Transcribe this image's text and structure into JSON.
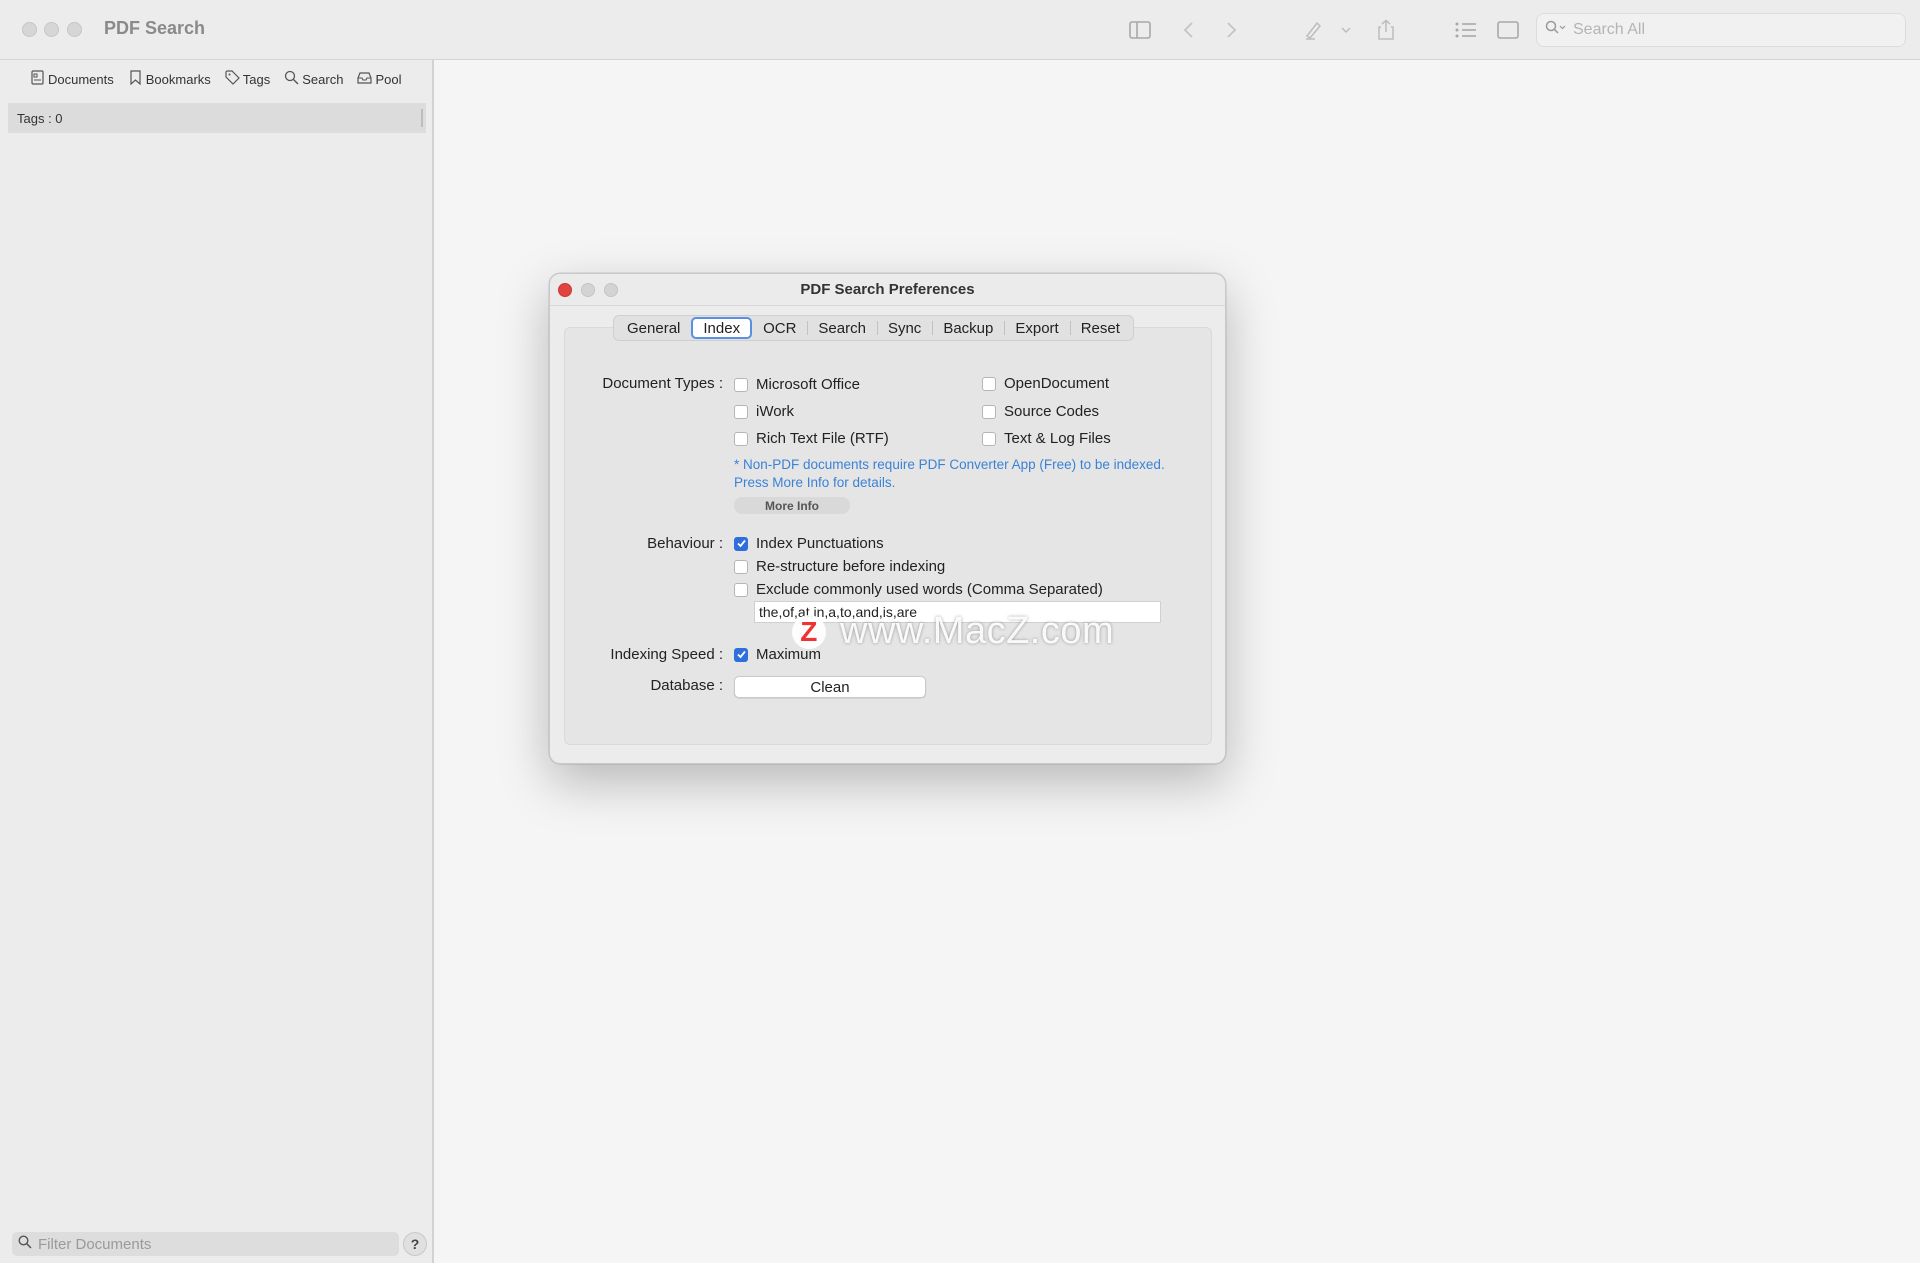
{
  "window": {
    "title": "PDF Search"
  },
  "toolbar": {
    "search_placeholder": "Search All",
    "icons": [
      "sidebar-toggle-icon",
      "back-icon",
      "forward-icon",
      "highlighter-icon",
      "chevron-down-icon",
      "share-icon",
      "list-icon",
      "single-page-icon",
      "search-icon"
    ]
  },
  "sidebar": {
    "tabs": [
      {
        "label": "Documents",
        "icon": "documents-icon"
      },
      {
        "label": "Bookmarks",
        "icon": "bookmark-icon"
      },
      {
        "label": "Tags",
        "icon": "tag-icon"
      },
      {
        "label": "Search",
        "icon": "search-icon"
      },
      {
        "label": "Pool",
        "icon": "tray-icon"
      }
    ],
    "tags_count_label": "Tags : 0",
    "filter_placeholder": "Filter Documents",
    "help_label": "?"
  },
  "dialog": {
    "title": "PDF Search Preferences",
    "tabs": [
      "General",
      "Index",
      "OCR",
      "Search",
      "Sync",
      "Backup",
      "Export",
      "Reset"
    ],
    "active_tab": "Index",
    "document_types": {
      "label": "Document Types :",
      "options": [
        {
          "label": "Microsoft Office",
          "checked": false
        },
        {
          "label": "OpenDocument",
          "checked": false
        },
        {
          "label": "iWork",
          "checked": false
        },
        {
          "label": "Source Codes",
          "checked": false
        },
        {
          "label": "Rich Text File (RTF)",
          "checked": false
        },
        {
          "label": "Text & Log Files",
          "checked": false
        }
      ],
      "note_line1": "* Non-PDF documents require PDF Converter App (Free) to be indexed.",
      "note_line2": "Press More Info for details.",
      "more_info_label": "More Info"
    },
    "behaviour": {
      "label": "Behaviour :",
      "options": [
        {
          "label": "Index Punctuations",
          "checked": true
        },
        {
          "label": "Re-structure before indexing",
          "checked": false
        },
        {
          "label": "Exclude commonly used words (Comma Separated)",
          "checked": false
        }
      ],
      "words_value": "the,of,at,in,a,to,and,is,are"
    },
    "indexing_speed": {
      "label": "Indexing Speed :",
      "option": {
        "label": "Maximum",
        "checked": true
      }
    },
    "database": {
      "label": "Database :",
      "button_label": "Clean"
    }
  },
  "watermark": {
    "logo": "Z",
    "text": "www.MacZ.com"
  },
  "colors": {
    "accent": "#2f6fdd",
    "note_text": "#3b82d6",
    "close_red": "#e0443e"
  }
}
